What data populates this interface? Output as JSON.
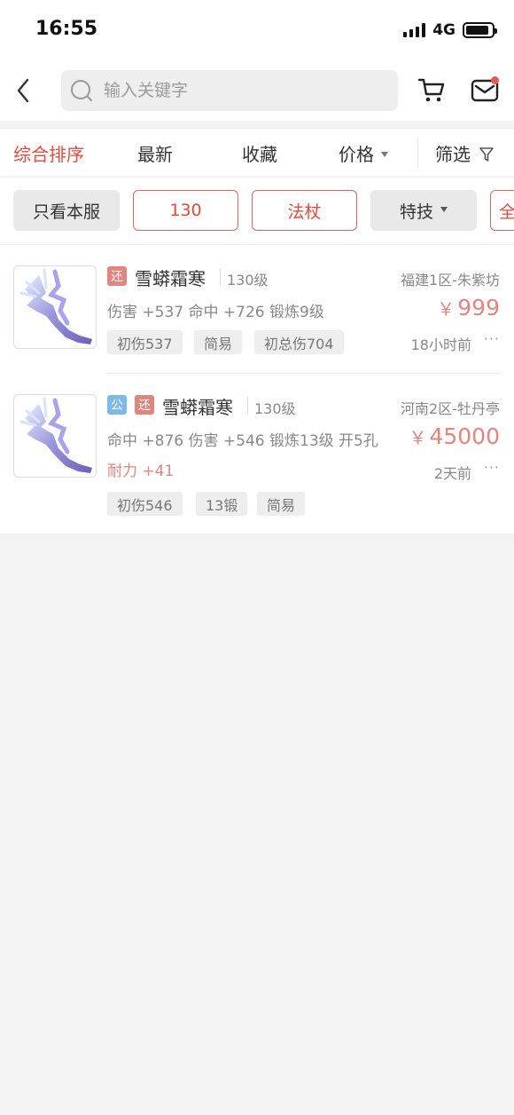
{
  "status_bar": {
    "time": "16:55",
    "network": "4G"
  },
  "search": {
    "placeholder": "输入关键字"
  },
  "sort_tabs": [
    {
      "label": "综合排序",
      "active": true
    },
    {
      "label": "最新"
    },
    {
      "label": "收藏"
    },
    {
      "label": "价格"
    },
    {
      "label": "筛选"
    }
  ],
  "filters": {
    "server_only": "只看本服",
    "level": "130",
    "weapon_type": "法杖",
    "special_skill": "特技",
    "all": "全"
  },
  "items": [
    {
      "badges": [
        "还"
      ],
      "name": "雪蟒霜寒",
      "level": "130级",
      "server": "福建1区-朱紫坊",
      "stats": "伤害 +537 命中 +726 锻炼9级",
      "price": "999",
      "currency": "￥",
      "tags": [
        "初伤537",
        "简易",
        "初总伤704"
      ],
      "time": "18小时前",
      "more": "···"
    },
    {
      "badges": [
        "公",
        "还"
      ],
      "name": "雪蟒霜寒",
      "level": "130级",
      "server": "河南2区-牡丹亭",
      "stats": "命中 +876 伤害 +546 锻炼13级 开5孔",
      "extra_stat": "耐力 +41",
      "price": "45000",
      "currency": "￥",
      "tags": [
        "初伤546",
        "13锻",
        "简易"
      ],
      "time": "2天前",
      "more": "···"
    }
  ],
  "colors": {
    "accent": "#e04a3f",
    "price": "#e2857f",
    "badge_blue": "#7dbbe6"
  }
}
